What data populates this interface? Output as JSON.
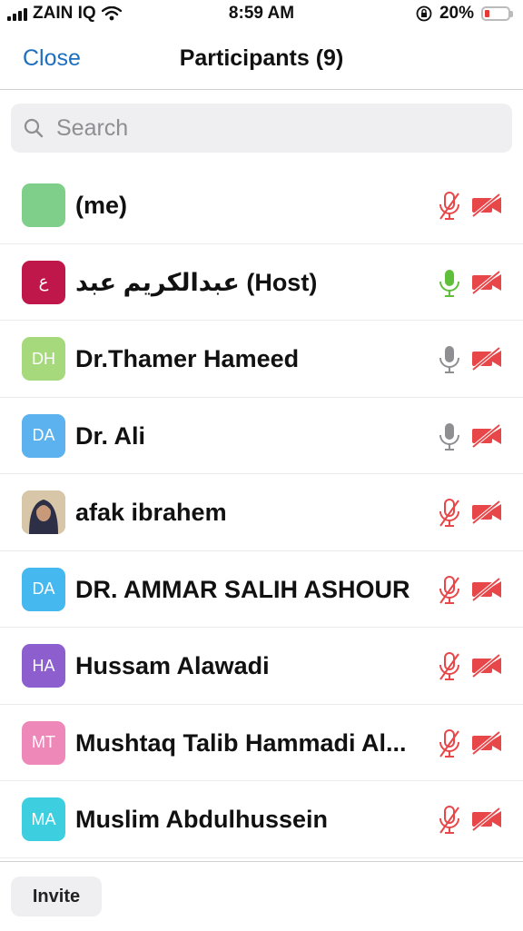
{
  "status_bar": {
    "carrier": "ZAIN IQ",
    "time": "8:59 AM",
    "battery": "20%",
    "battery_level": 0.2,
    "battery_color": "#e53935",
    "icons": [
      "signal-icon",
      "wifi-icon",
      "orientation-lock-icon",
      "battery-icon"
    ]
  },
  "nav": {
    "close_label": "Close",
    "title": "Participants (9)",
    "accent_color": "#1f6fbf"
  },
  "search": {
    "placeholder": "Search",
    "value": ""
  },
  "participants": [
    {
      "name": "(me)",
      "initials": "",
      "avatar_color": "#7fcf8a",
      "mic": "muted",
      "video": "off"
    },
    {
      "name": "عبدالكريم عبد (Host)",
      "initials": "ع",
      "avatar_color": "#c0174a",
      "mic": "active",
      "video": "off"
    },
    {
      "name": "Dr.Thamer Hameed",
      "initials": "DH",
      "avatar_color": "#a6d97c",
      "mic": "unmuted",
      "video": "off"
    },
    {
      "name": "Dr. Ali",
      "initials": "DA",
      "avatar_color": "#5bb2ef",
      "mic": "unmuted",
      "video": "off"
    },
    {
      "name": "afak ibrahem",
      "initials": "",
      "avatar_color": "#c9b79c",
      "avatar_type": "photo",
      "mic": "muted",
      "video": "off"
    },
    {
      "name": "DR. AMMAR SALIH ASHOUR",
      "initials": "DA",
      "avatar_color": "#45b8ef",
      "mic": "muted",
      "video": "off"
    },
    {
      "name": "Hussam Alawadi",
      "initials": "HA",
      "avatar_color": "#8d5fce",
      "mic": "muted",
      "video": "off"
    },
    {
      "name": "Mushtaq Talib Hammadi Al...",
      "initials": "MT",
      "avatar_color": "#ee88b8",
      "mic": "muted",
      "video": "off"
    },
    {
      "name": "Muslim Abdulhussein",
      "initials": "MA",
      "avatar_color": "#3dcfe0",
      "mic": "muted",
      "video": "off"
    }
  ],
  "footer": {
    "invite_label": "Invite"
  }
}
